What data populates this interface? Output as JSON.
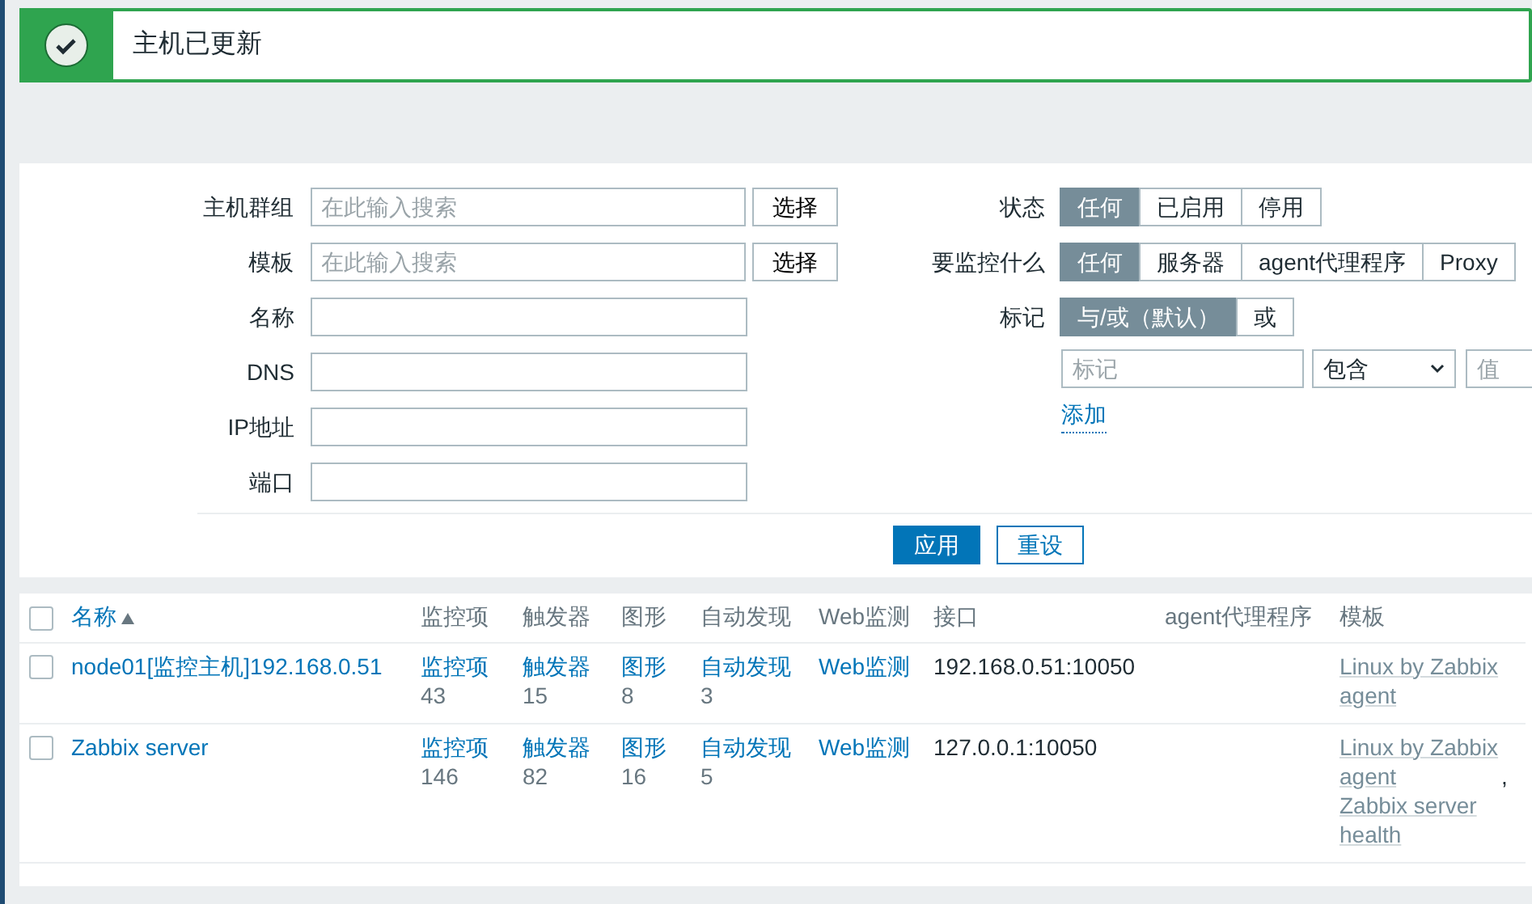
{
  "message": {
    "kind": "success",
    "text": "主机已更新"
  },
  "filter": {
    "left": [
      {
        "kind": "multiselect",
        "label": "主机群组",
        "placeholder": "在此输入搜索",
        "button": "选择"
      },
      {
        "kind": "multiselect",
        "label": "模板",
        "placeholder": "在此输入搜索",
        "button": "选择"
      },
      {
        "kind": "text",
        "label": "名称"
      },
      {
        "kind": "text",
        "label": "DNS"
      },
      {
        "kind": "text",
        "label": "IP地址"
      },
      {
        "kind": "text",
        "label": "端口"
      }
    ],
    "right": [
      {
        "kind": "segmented",
        "label": "状态",
        "options": [
          {
            "label": "任何",
            "selected": true
          },
          {
            "label": "已启用",
            "selected": false
          },
          {
            "label": "停用",
            "selected": false
          }
        ]
      },
      {
        "kind": "segmented",
        "label": "要监控什么",
        "options": [
          {
            "label": "任何",
            "selected": true
          },
          {
            "label": "服务器",
            "selected": false
          },
          {
            "label": "agent代理程序",
            "selected": false
          },
          {
            "label": "Proxy",
            "selected": false
          }
        ]
      },
      {
        "kind": "segmented",
        "label": "标记",
        "options": [
          {
            "label": "与/或（默认）",
            "selected": true
          },
          {
            "label": "或",
            "selected": false
          }
        ]
      }
    ],
    "tag_row": {
      "tag_placeholder": "标记",
      "operator": "包含",
      "value_placeholder": "值"
    },
    "add_link": "添加",
    "apply": "应用",
    "reset": "重设"
  },
  "table": {
    "all_checked": false,
    "columns": [
      {
        "label": "名称",
        "sorted": true
      },
      {
        "label": "监控项"
      },
      {
        "label": "触发器"
      },
      {
        "label": "图形"
      },
      {
        "label": "自动发现"
      },
      {
        "label": "Web监测"
      },
      {
        "label": "接口"
      },
      {
        "label": "agent代理程序"
      },
      {
        "label": "模板"
      }
    ],
    "rows": [
      {
        "checked": false,
        "name": "node01[监控主机]192.168.0.51",
        "items": {
          "label": "监控项",
          "count": "43"
        },
        "triggers": {
          "label": "触发器",
          "count": "15"
        },
        "graphs": {
          "label": "图形",
          "count": "8"
        },
        "discovery": {
          "label": "自动发现",
          "count": "3"
        },
        "web": "Web监测",
        "interface": "192.168.0.51:10050",
        "templates": [
          {
            "name": "Linux by Zabbix agent"
          }
        ]
      },
      {
        "checked": false,
        "name": "Zabbix server",
        "items": {
          "label": "监控项",
          "count": "146"
        },
        "triggers": {
          "label": "触发器",
          "count": "82"
        },
        "graphs": {
          "label": "图形",
          "count": "16"
        },
        "discovery": {
          "label": "自动发现",
          "count": "5"
        },
        "web": "Web监测",
        "interface": "127.0.0.1:10050",
        "templates": [
          {
            "name": "Linux by Zabbix agent",
            "separator": ","
          },
          {
            "name": "Zabbix server health"
          }
        ]
      }
    ]
  }
}
